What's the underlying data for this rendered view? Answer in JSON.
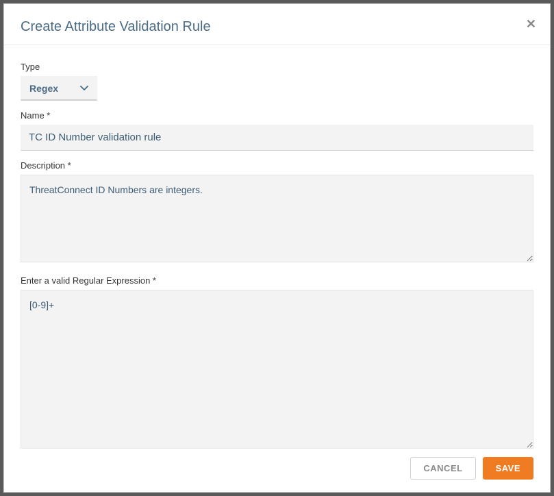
{
  "modal": {
    "title": "Create Attribute Validation Rule"
  },
  "fields": {
    "type": {
      "label": "Type",
      "value": "Regex"
    },
    "name": {
      "label": "Name *",
      "value": "TC ID Number validation rule"
    },
    "description": {
      "label": "Description *",
      "value": "ThreatConnect ID Numbers are integers."
    },
    "regex": {
      "label": "Enter a valid Regular Expression *",
      "value": "[0-9]+"
    }
  },
  "buttons": {
    "cancel": "CANCEL",
    "save": "SAVE"
  }
}
